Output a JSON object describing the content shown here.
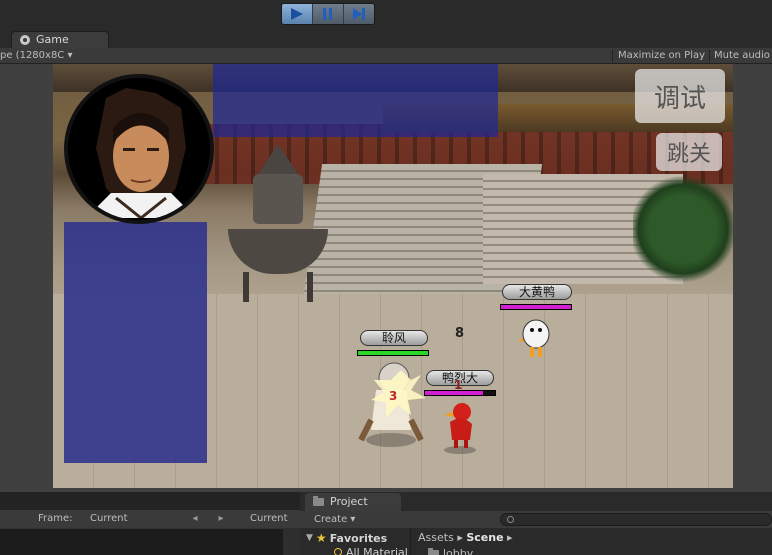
{
  "toolbar": {
    "play_icon": "play-icon",
    "pause_icon": "pause-icon",
    "step_icon": "step-icon",
    "accent": "#5a82ad"
  },
  "game_tab": {
    "label": "Game",
    "icon": "game-icon"
  },
  "game_toolbar": {
    "aspect": "pe (1280x8C ▾",
    "maximize_on_play": "Maximize on Play",
    "mute_audio": "Mute audio"
  },
  "game": {
    "debug_button": "调试",
    "skip_button": "跳关",
    "player": {
      "name": "聆风",
      "hp_fraction": 1.0,
      "hp_color": "#2bd62b",
      "hit_damage": "3"
    },
    "enemies": [
      {
        "name": "大黄鸭",
        "hp_fraction": 1.0,
        "hp_color": "#d020d0"
      },
      {
        "name": "鸭烈大",
        "hp_fraction": 0.83,
        "hp_color": "#d020d0"
      }
    ],
    "combo_number": "8",
    "enemy_damage": "1"
  },
  "animation_panel": {
    "frame_label": "Frame:",
    "current_left": "Current",
    "current_right": "Current"
  },
  "project_panel": {
    "tab_label": "Project",
    "create_label": "Create ▾",
    "favorites_label": "Favorites",
    "all_materials": "All Material",
    "breadcrumb_assets": "Assets",
    "breadcrumb_scene": "Scene",
    "folder_item": "lobby"
  }
}
